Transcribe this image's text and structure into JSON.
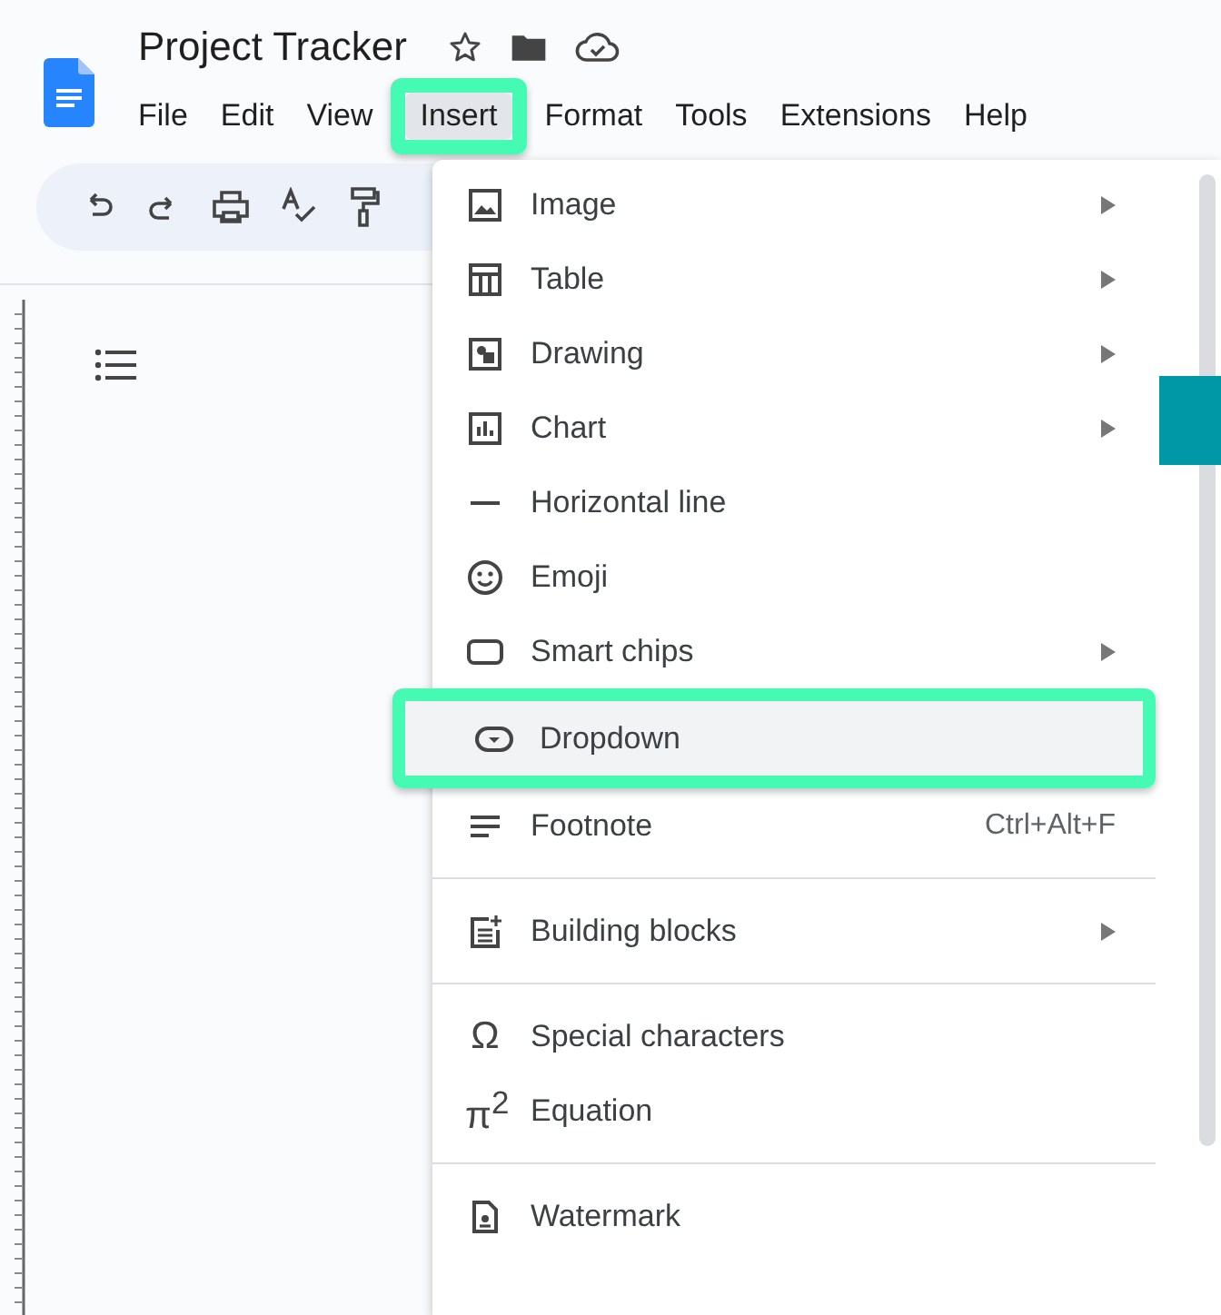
{
  "document": {
    "title": "Project Tracker"
  },
  "menu_bar": [
    {
      "label": "File",
      "selected": false,
      "highlighted": false
    },
    {
      "label": "Edit",
      "selected": false,
      "highlighted": false
    },
    {
      "label": "View",
      "selected": false,
      "highlighted": false
    },
    {
      "label": "Insert",
      "selected": true,
      "highlighted": true
    },
    {
      "label": "Format",
      "selected": false,
      "highlighted": false
    },
    {
      "label": "Tools",
      "selected": false,
      "highlighted": false
    },
    {
      "label": "Extensions",
      "selected": false,
      "highlighted": false
    },
    {
      "label": "Help",
      "selected": false,
      "highlighted": false
    }
  ],
  "insert_menu": {
    "sections": [
      [
        {
          "label": "Image",
          "submenu": true,
          "selected": false,
          "highlighted": false
        },
        {
          "label": "Table",
          "submenu": true,
          "selected": false,
          "highlighted": false
        },
        {
          "label": "Drawing",
          "submenu": true,
          "selected": false,
          "highlighted": false
        },
        {
          "label": "Chart",
          "submenu": true,
          "selected": false,
          "highlighted": false
        },
        {
          "label": "Horizontal line",
          "submenu": false,
          "selected": false,
          "highlighted": false
        },
        {
          "label": "Emoji",
          "submenu": false,
          "selected": false,
          "highlighted": false
        },
        {
          "label": "Smart chips",
          "submenu": true,
          "selected": false,
          "highlighted": false
        },
        {
          "label": "Dropdown",
          "submenu": false,
          "selected": true,
          "highlighted": true
        },
        {
          "label": "Footnote",
          "submenu": false,
          "selected": false,
          "highlighted": false,
          "shortcut": "Ctrl+Alt+F"
        }
      ],
      [
        {
          "label": "Building blocks",
          "submenu": true,
          "selected": false,
          "highlighted": false
        }
      ],
      [
        {
          "label": "Special characters",
          "submenu": false,
          "selected": false,
          "highlighted": false,
          "glyph": "Ω"
        },
        {
          "label": "Equation",
          "submenu": false,
          "selected": false,
          "highlighted": false,
          "glyph": "π$^{2}$"
        }
      ],
      [
        {
          "label": "Watermark",
          "submenu": false,
          "selected": false,
          "highlighted": false
        }
      ]
    ]
  }
}
